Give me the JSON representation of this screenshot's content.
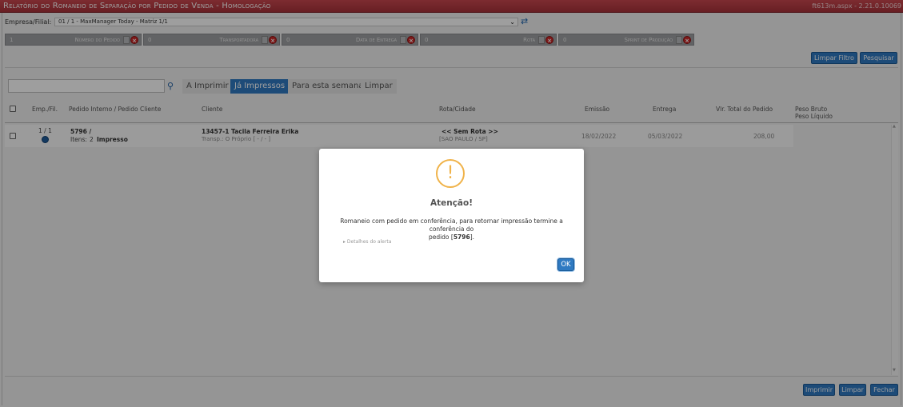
{
  "window": {
    "title": "Relatório do Romaneio de Separação por Pedido de Venda - Homologação",
    "version": "ft613m.aspx - 2.21.0.10069"
  },
  "empresa": {
    "label": "Empresa/Filial:",
    "value": "01 / 1 - MaxManager Today - Matriz 1/1"
  },
  "filters": [
    {
      "value": "1",
      "label": "Número do Pedido"
    },
    {
      "value": "0",
      "label": "Transportadora"
    },
    {
      "value": "0",
      "label": "Data de Entrega"
    },
    {
      "value": "0",
      "label": "Rota"
    },
    {
      "value": "0",
      "label": "Sprint de Produção"
    }
  ],
  "filter_buttons": {
    "limpar_filtro": "Limpar Filtro",
    "pesquisar": "Pesquisar"
  },
  "tabs": [
    "A Imprimir",
    "Já Impressos",
    "Para esta semana",
    "Limpar"
  ],
  "active_tab": "Já Impressos",
  "grid": {
    "headers": {
      "emp": "Emp./Fil.",
      "pedido": "Pedido Interno / Pedido Cliente",
      "cliente": "Cliente",
      "rota": "Rota/Cidade",
      "emissao": "Emissão",
      "entrega": "Entrega",
      "valor": "Vlr. Total do Pedido",
      "peso_bruto": "Peso Bruto",
      "peso_liquido": "Peso Líquido"
    },
    "rows": [
      {
        "emp": "1 / 1",
        "pedido": "5796 /",
        "itens_label": "Itens:",
        "itens": "2",
        "status": "Impresso",
        "cliente": "13457-1 Tacila Ferreira Erika",
        "transp": "Transp.: O Próprio [ - / - ]",
        "rota": "<< Sem Rota >>",
        "cidade": "[SAO PAULO / SP]",
        "emissao": "18/02/2022",
        "entrega": "05/03/2022",
        "valor": "208,00"
      }
    ]
  },
  "footer_buttons": {
    "imprimir": "Imprimir",
    "limpar": "Limpar",
    "fechar": "Fechar"
  },
  "modal": {
    "icon": "!",
    "title": "Atenção!",
    "message_line1": "Romaneio com pedido em conferência, para retornar impressão termine a conferência do",
    "message_line2_pre": "pedido [",
    "message_order": "5796",
    "message_line2_post": "].",
    "details": "▸ Detalhes do alerta",
    "ok": "OK"
  },
  "colors": {
    "titlebar": "#b23a42",
    "accent": "#2f7ac2",
    "warning": "#f0b34a",
    "filter_bg": "#9ea0a3",
    "remove": "#cc2a2a"
  }
}
